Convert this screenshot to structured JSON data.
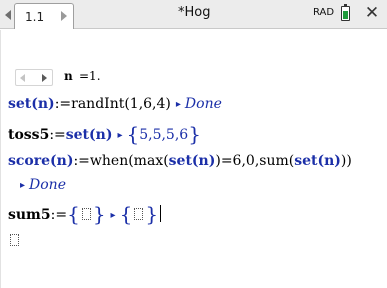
{
  "tab": {
    "label": "1.1"
  },
  "document": {
    "title": "*Hog"
  },
  "status": {
    "angle_mode": "RAD",
    "battery_level": 0.75,
    "battery_color": "#1f9a3b"
  },
  "slider": {
    "variable": "n",
    "value_text": "=1."
  },
  "lines": {
    "l1": {
      "lhs": "set(n)",
      "assign": ":=",
      "rhs": "randInt(1,6,4)",
      "result": "Done"
    },
    "l2": {
      "lhs": "toss5",
      "assign": ":=",
      "rhs": "set(n)",
      "result": "5,5,5,6"
    },
    "l3": {
      "lhs": "score(n)",
      "assign": ":=",
      "rhs_a": "when(max(",
      "rhs_b": "set(n)",
      "rhs_c": ")=6,0,sum(",
      "rhs_d": "set(n)",
      "rhs_e": "))",
      "result": "Done"
    },
    "l4": {
      "lhs": "sum5",
      "assign": ":="
    }
  },
  "colors": {
    "output": "#1b2fa8",
    "topbar": "#ececec"
  }
}
